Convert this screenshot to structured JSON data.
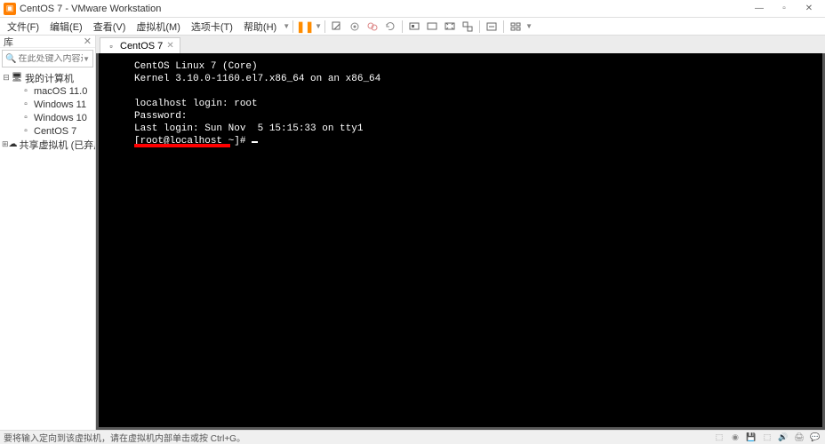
{
  "titlebar": {
    "title": "CentOS 7 - VMware Workstation"
  },
  "menubar": {
    "file": "文件(F)",
    "edit": "编辑(E)",
    "view": "查看(V)",
    "vm": "虚拟机(M)",
    "tabs": "选项卡(T)",
    "help": "帮助(H)"
  },
  "sidebar": {
    "header": "库",
    "search_placeholder": "在此处键入内容进行搜索",
    "items": [
      {
        "label": "我的计算机",
        "depth": 0,
        "expanded": true,
        "icon": "computer"
      },
      {
        "label": "macOS 11.0",
        "depth": 1,
        "icon": "vm"
      },
      {
        "label": "Windows 11",
        "depth": 1,
        "icon": "vm"
      },
      {
        "label": "Windows 10",
        "depth": 1,
        "icon": "vm"
      },
      {
        "label": "CentOS 7",
        "depth": 1,
        "icon": "vm"
      },
      {
        "label": "共享虚拟机 (已弃用)",
        "depth": 0,
        "expanded": false,
        "icon": "shared"
      }
    ]
  },
  "tab": {
    "label": "CentOS 7"
  },
  "terminal": {
    "l1": "CentOS Linux 7 (Core)",
    "l2": "Kernel 3.10.0-1160.el7.x86_64 on an x86_64",
    "l3": "",
    "l4": "localhost login: root",
    "l5": "Password:",
    "l6": "Last login: Sun Nov  5 15:15:33 on tty1",
    "l7": "[root@localhost ~]# "
  },
  "statusbar": {
    "hint": "要将输入定向到该虚拟机，请在虚拟机内部单击或按 Ctrl+G。"
  }
}
